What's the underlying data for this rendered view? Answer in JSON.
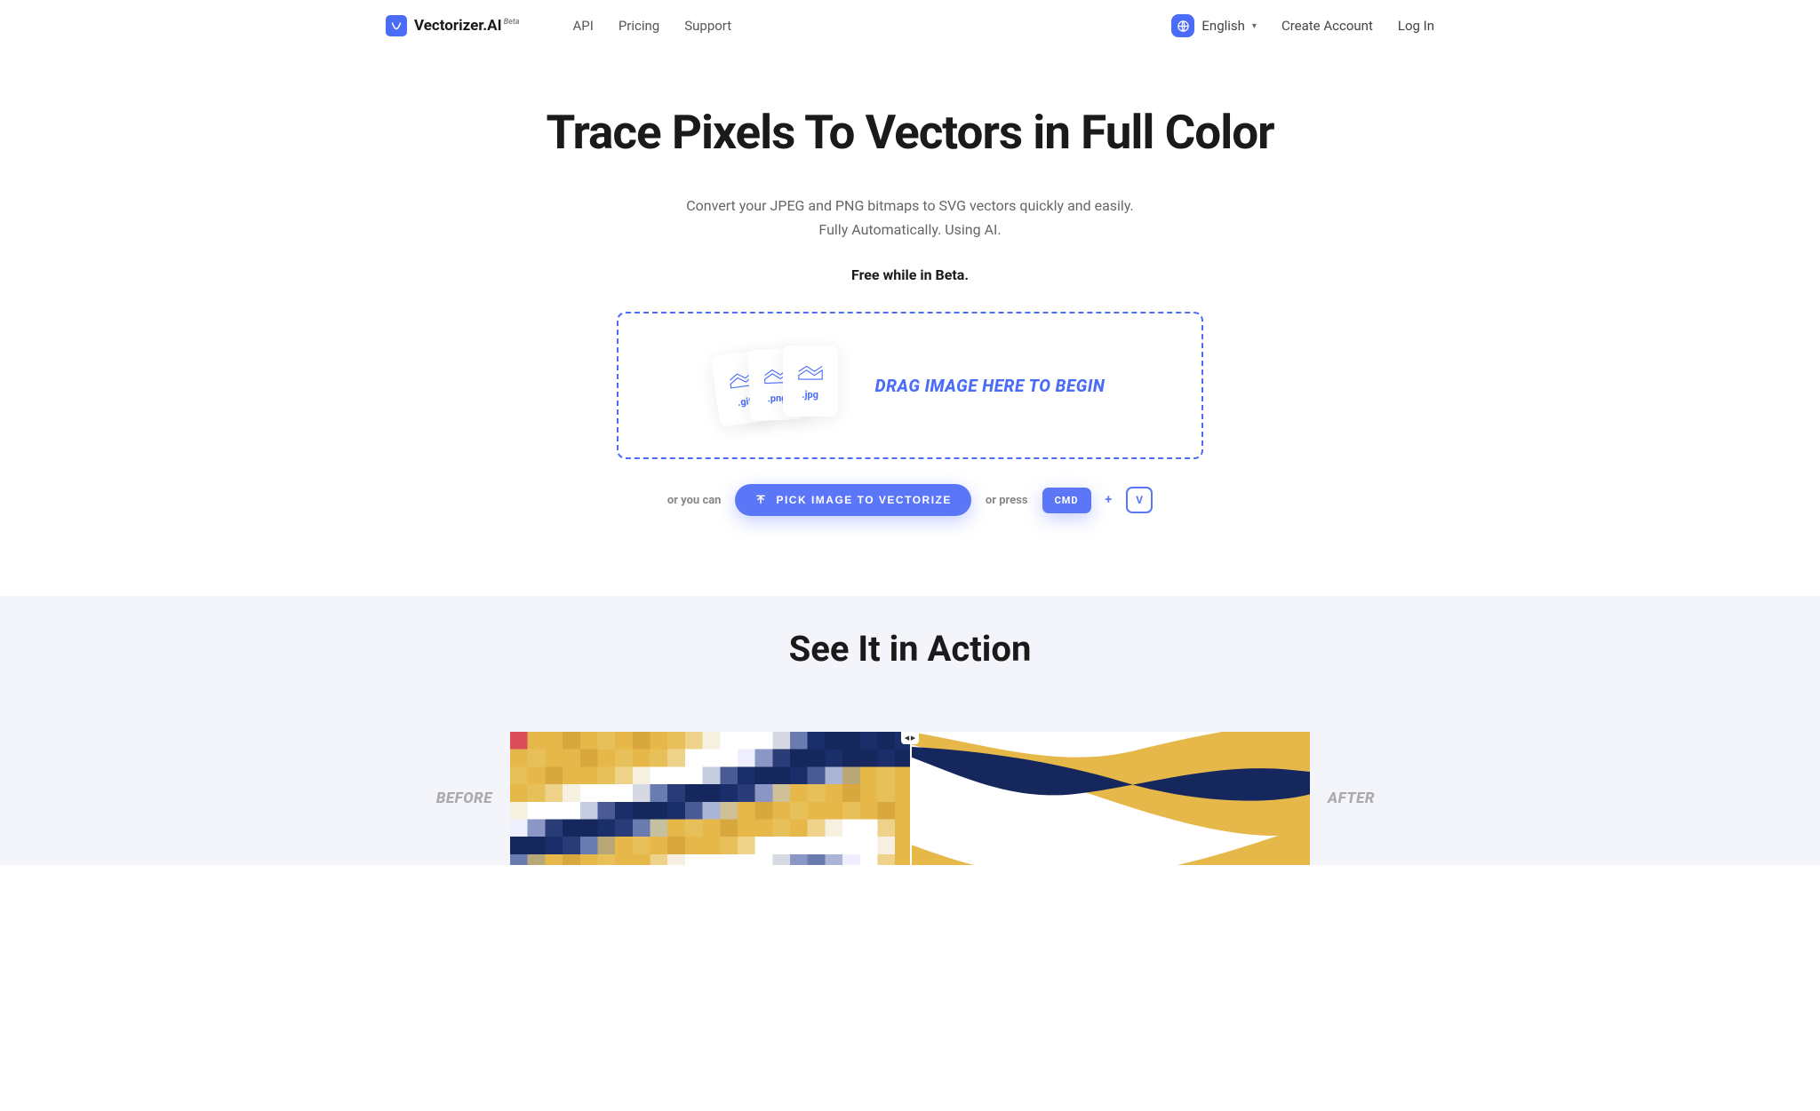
{
  "header": {
    "brand": "Vectorizer.AI",
    "beta": "Beta",
    "nav": {
      "api": "API",
      "pricing": "Pricing",
      "support": "Support"
    },
    "language": "English",
    "create_account": "Create Account",
    "login": "Log In"
  },
  "hero": {
    "title": "Trace Pixels To Vectors in Full Color",
    "sub1": "Convert your JPEG and PNG bitmaps to SVG vectors quickly and easily.",
    "sub2": "Fully Automatically. Using AI.",
    "beta_notice": "Free while in Beta.",
    "drop_text": "DRAG IMAGE HERE TO BEGIN",
    "file_types": {
      "gif": ".gif",
      "png": ".png",
      "jpg": ".jpg"
    },
    "alt_prefix": "or you can",
    "pick_button": "PICK IMAGE TO VECTORIZE",
    "press_prefix": "or press",
    "key_cmd": "CMD",
    "plus": "+",
    "key_v": "V"
  },
  "action": {
    "title": "See It in Action",
    "before": "BEFORE",
    "after": "AFTER"
  }
}
